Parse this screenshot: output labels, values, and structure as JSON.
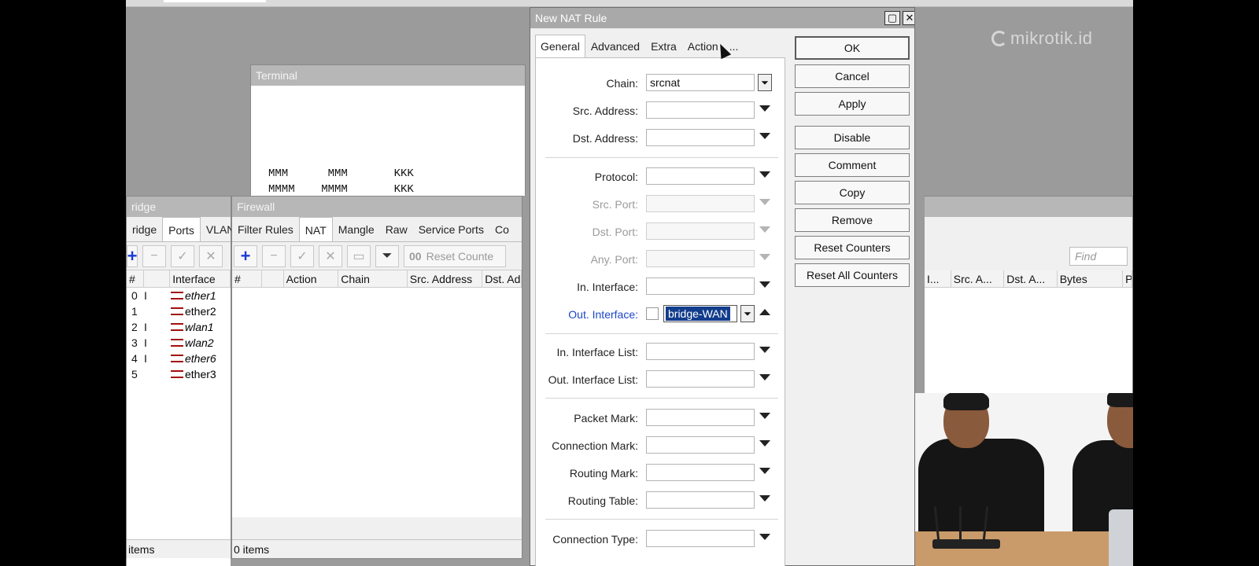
{
  "brand": {
    "logo_text": "mikrotik.id"
  },
  "terminal": {
    "title": "Terminal",
    "lines": [
      "MMM      MMM       KKK",
      "MMMM    MMMM       KKK"
    ]
  },
  "bridge": {
    "title": "ridge",
    "tabs": [
      "ridge",
      "Ports",
      "VLAN"
    ],
    "active_tab": "Ports",
    "columns": [
      "#",
      "",
      "Interface"
    ],
    "rows": [
      {
        "num": "0",
        "flag": "I",
        "interface": "ether1",
        "italic": true
      },
      {
        "num": "1",
        "flag": "",
        "interface": "ether2",
        "italic": false
      },
      {
        "num": "2",
        "flag": "I",
        "interface": "wlan1",
        "italic": true
      },
      {
        "num": "3",
        "flag": "I",
        "interface": "wlan2",
        "italic": true
      },
      {
        "num": "4",
        "flag": "I",
        "interface": "ether6",
        "italic": true
      },
      {
        "num": "5",
        "flag": "",
        "interface": "ether3",
        "italic": false
      }
    ],
    "status": "items"
  },
  "firewall": {
    "title": "Firewall",
    "tabs": [
      "Filter Rules",
      "NAT",
      "Mangle",
      "Raw",
      "Service Ports",
      "Co"
    ],
    "active_tab": "NAT",
    "toolbar": {
      "reset_counters": "Reset Counte"
    },
    "columns": [
      "#",
      "",
      "Action",
      "Chain",
      "Src. Address",
      "Dst. Ad"
    ],
    "status": "0 items"
  },
  "right_panel": {
    "find_placeholder": "Find",
    "columns": [
      "I...",
      "Src. A...",
      "Dst. A...",
      "Bytes",
      "P"
    ]
  },
  "dialog": {
    "title": "New NAT Rule",
    "tabs": [
      "General",
      "Advanced",
      "Extra",
      "Action",
      "..."
    ],
    "active_tab": "General",
    "fields": {
      "chain": {
        "label": "Chain:",
        "value": "srcnat"
      },
      "src_address": {
        "label": "Src. Address:",
        "value": ""
      },
      "dst_address": {
        "label": "Dst. Address:",
        "value": ""
      },
      "protocol": {
        "label": "Protocol:",
        "value": ""
      },
      "src_port": {
        "label": "Src. Port:",
        "value": ""
      },
      "dst_port": {
        "label": "Dst. Port:",
        "value": ""
      },
      "any_port": {
        "label": "Any. Port:",
        "value": ""
      },
      "in_interface": {
        "label": "In. Interface:",
        "value": ""
      },
      "out_interface": {
        "label": "Out. Interface:",
        "value": "bridge-WAN"
      },
      "in_interface_list": {
        "label": "In. Interface List:",
        "value": ""
      },
      "out_interface_list": {
        "label": "Out. Interface List:",
        "value": ""
      },
      "packet_mark": {
        "label": "Packet Mark:",
        "value": ""
      },
      "connection_mark": {
        "label": "Connection Mark:",
        "value": ""
      },
      "routing_mark": {
        "label": "Routing Mark:",
        "value": ""
      },
      "routing_table": {
        "label": "Routing Table:",
        "value": ""
      },
      "connection_type": {
        "label": "Connection Type:",
        "value": ""
      }
    },
    "buttons": {
      "ok": "OK",
      "cancel": "Cancel",
      "apply": "Apply",
      "disable": "Disable",
      "comment": "Comment",
      "copy": "Copy",
      "remove": "Remove",
      "reset_counters": "Reset Counters",
      "reset_all_counters": "Reset All Counters"
    }
  },
  "colors": {
    "desktop_bg": "#9b9b9b",
    "title_bar": "#b7b7b7",
    "selection": "#123c8c",
    "field_label_active": "#1b46c8",
    "add_icon": "#1a3bd6"
  }
}
